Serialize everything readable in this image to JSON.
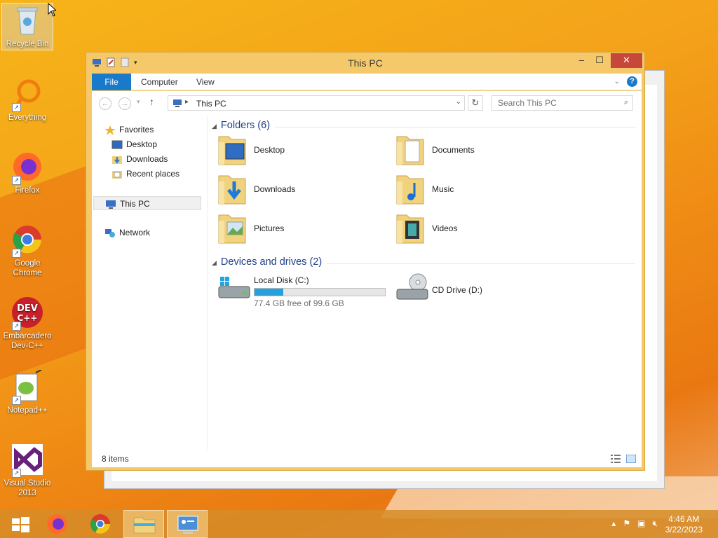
{
  "desktop": {
    "icons": [
      {
        "label": "Recycle Bin"
      },
      {
        "label": "Everything"
      },
      {
        "label": "Firefox"
      },
      {
        "label": "Google Chrome"
      },
      {
        "label": "Embarcadero Dev-C++"
      },
      {
        "label": "Notepad++"
      },
      {
        "label": "Visual Studio 2013"
      }
    ]
  },
  "window": {
    "title": "This PC",
    "controls": {
      "minimize": "–",
      "maximize": "☐",
      "close": "✕"
    }
  },
  "ribbon": {
    "tabs": [
      "File",
      "Computer",
      "View"
    ],
    "help": "?"
  },
  "navigation": {
    "address": "This PC",
    "search_placeholder": "Search This PC"
  },
  "nav_pane": {
    "favorites": "Favorites",
    "favorites_items": [
      "Desktop",
      "Downloads",
      "Recent places"
    ],
    "this_pc": "This PC",
    "network": "Network"
  },
  "main": {
    "folders_header": "Folders (6)",
    "folders": [
      "Desktop",
      "Documents",
      "Downloads",
      "Music",
      "Pictures",
      "Videos"
    ],
    "devices_header": "Devices and drives (2)",
    "drives": [
      {
        "name": "Local Disk (C:)",
        "detail": "77.4 GB free of 99.6 GB",
        "used_fraction": 0.223
      },
      {
        "name": "CD Drive (D:)"
      }
    ]
  },
  "status": {
    "items": "8 items"
  },
  "taskbar": {
    "clock_time": "4:46 AM",
    "clock_date": "3/22/2023"
  }
}
